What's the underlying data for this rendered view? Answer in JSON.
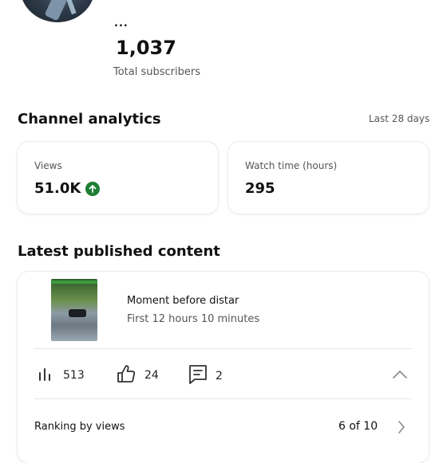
{
  "channel": {
    "name": "...",
    "subscriber_count": "1,037",
    "subscriber_label": "Total subscribers"
  },
  "analytics": {
    "title": "Channel analytics",
    "range": "Last 28 days",
    "views": {
      "label": "Views",
      "value": "51.0K"
    },
    "watch_time": {
      "label": "Watch time (hours)",
      "value": "295"
    }
  },
  "latest": {
    "title": "Latest published content",
    "video": {
      "title": "Moment before distar",
      "time": "First 12 hours 10 minutes",
      "views": "513",
      "likes": "24",
      "comments": "2"
    },
    "ranking": {
      "label": "Ranking by views",
      "value": "6 of 10"
    }
  },
  "colors": {
    "accent_up": "#1e7e34",
    "divider": "#e6e6e6"
  }
}
